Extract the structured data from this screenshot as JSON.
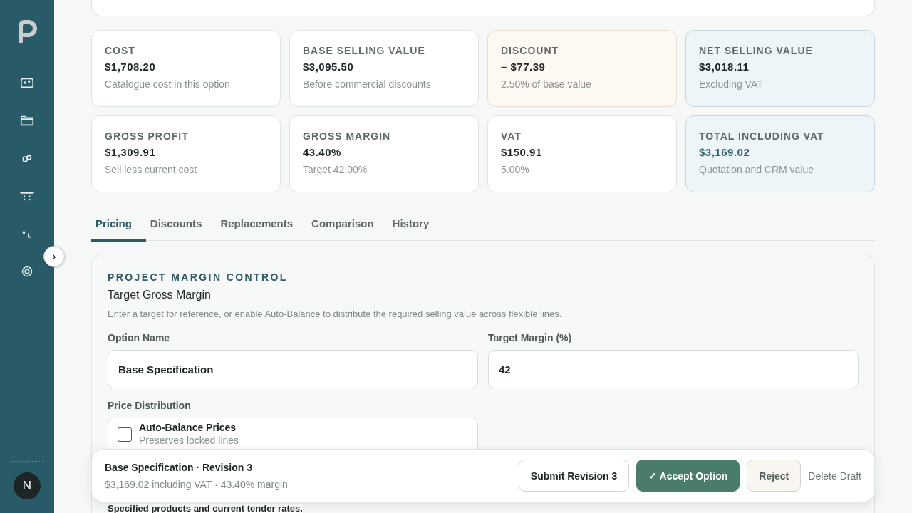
{
  "sidebar": {
    "items": [
      {
        "selected": false
      },
      {
        "selected": false
      },
      {
        "selected": false
      },
      {
        "selected": false
      },
      {
        "selected": false
      },
      {
        "selected": false
      }
    ],
    "expand_button": "›",
    "avatar": "N"
  },
  "summary_cards": [
    {
      "label": "COST",
      "value": "$1,708.20",
      "note": "Catalogue cost in this option",
      "kind": "plain",
      "highlight": false
    },
    {
      "label": "BASE SELLING VALUE",
      "value": "$3,095.50",
      "note": "Before commercial discounts",
      "kind": "plain",
      "highlight": false
    },
    {
      "label": "DISCOUNT",
      "value": "– $77.39",
      "note": "2.50% of base value",
      "kind": "warm",
      "highlight": false
    },
    {
      "label": "NET SELLING VALUE",
      "value": "$3,018.11",
      "note": "Excluding VAT",
      "kind": "cool",
      "highlight": false
    },
    {
      "label": "GROSS PROFIT",
      "value": "$1,309.91",
      "note": "Sell less current cost",
      "kind": "plain",
      "highlight": false
    },
    {
      "label": "GROSS MARGIN",
      "value": "43.40%",
      "note": "Target 42.00%",
      "kind": "plain",
      "highlight": false
    },
    {
      "label": "VAT",
      "value": "$150.91",
      "note": "5.00%",
      "kind": "plain",
      "highlight": false
    },
    {
      "label": "TOTAL INCLUDING VAT",
      "value": "$3,169.02",
      "note": "Quotation and CRM value",
      "kind": "cool",
      "highlight": true
    }
  ],
  "tabs": [
    {
      "label": "Pricing",
      "selected": true
    },
    {
      "label": "Discounts",
      "selected": false
    },
    {
      "label": "Replacements",
      "selected": false
    },
    {
      "label": "Comparison",
      "selected": false
    },
    {
      "label": "History",
      "selected": false
    }
  ],
  "panel": {
    "eyebrow": "PROJECT MARGIN CONTROL",
    "title": "Target Gross Margin",
    "description": "Enter a target for reference, or enable Auto-Balance to distribute the required selling value across flexible lines.",
    "fields": [
      {
        "label": "Option Name",
        "value": "Base Specification"
      },
      {
        "label": "Target Margin (%)",
        "value": "42"
      }
    ],
    "distribution": {
      "label": "Price Distribution",
      "option": "Auto-Balance Prices",
      "hint": "Preserves locked lines",
      "checked": false
    },
    "section_note": "Specified products and current tender rates."
  },
  "action_bar": {
    "title": "Base Specification · Revision 3",
    "subtitle": "$3,169.02 including VAT · 43.40% margin",
    "buttons": [
      {
        "label": "Submit Revision 3",
        "kind": "outline"
      },
      {
        "label": "✓ Accept Option",
        "kind": "primary"
      },
      {
        "label": "Reject",
        "kind": "muted"
      },
      {
        "label": "Delete Draft",
        "kind": "link"
      }
    ]
  }
}
